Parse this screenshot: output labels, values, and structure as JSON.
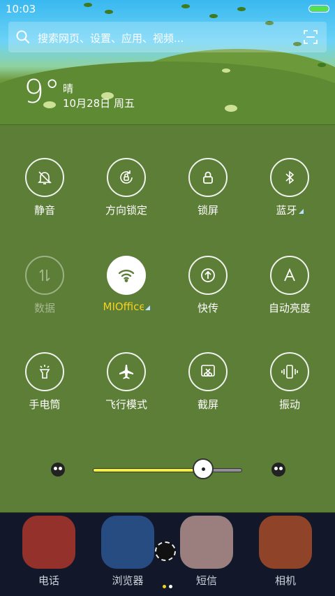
{
  "status_bar": {
    "time": "10:03",
    "battery_level": 1.0,
    "battery_color": "#58e04a"
  },
  "search": {
    "placeholder": "搜索网页、设置、应用、视频...",
    "icon": "search-icon",
    "right_icon": "scan-icon"
  },
  "weather": {
    "temperature": "9°",
    "condition": "晴",
    "date": "10月28日 周五"
  },
  "toggles": [
    {
      "label": "静音",
      "icon": "bell-off-icon",
      "state": "off"
    },
    {
      "label": "方向锁定",
      "icon": "rotation-lock-icon",
      "state": "off"
    },
    {
      "label": "锁屏",
      "icon": "lock-icon",
      "state": "off"
    },
    {
      "label": "蓝牙",
      "icon": "bluetooth-icon",
      "state": "off",
      "has_menu": true
    },
    {
      "label": "数据",
      "icon": "mobile-data-icon",
      "state": "disabled"
    },
    {
      "label": "MIOffice",
      "icon": "wifi-icon",
      "state": "on",
      "has_menu": true
    },
    {
      "label": "快传",
      "icon": "quick-share-icon",
      "state": "off"
    },
    {
      "label": "自动亮度",
      "icon": "auto-brightness-icon",
      "state": "off"
    },
    {
      "label": "手电筒",
      "icon": "flashlight-icon",
      "state": "off"
    },
    {
      "label": "飞行模式",
      "icon": "airplane-icon",
      "state": "off"
    },
    {
      "label": "截屏",
      "icon": "screenshot-icon",
      "state": "off"
    },
    {
      "label": "振动",
      "icon": "vibrate-icon",
      "state": "off"
    }
  ],
  "brightness": {
    "level": 0.74,
    "fill_color": "#f2f236"
  },
  "dock": [
    {
      "label": "电话",
      "icon": "phone-app-icon",
      "color": "#c0392b"
    },
    {
      "label": "浏览器",
      "icon": "browser-app-icon",
      "color": "#2d5da0"
    },
    {
      "label": "短信",
      "icon": "messages-app-icon",
      "color": "#c9a29c"
    },
    {
      "label": "相机",
      "icon": "camera-app-icon",
      "color": "#b9532a"
    }
  ],
  "pager": {
    "count": 2,
    "current": 0
  },
  "colors": {
    "panel": "#5d7e37",
    "accent": "#f5d21e"
  }
}
